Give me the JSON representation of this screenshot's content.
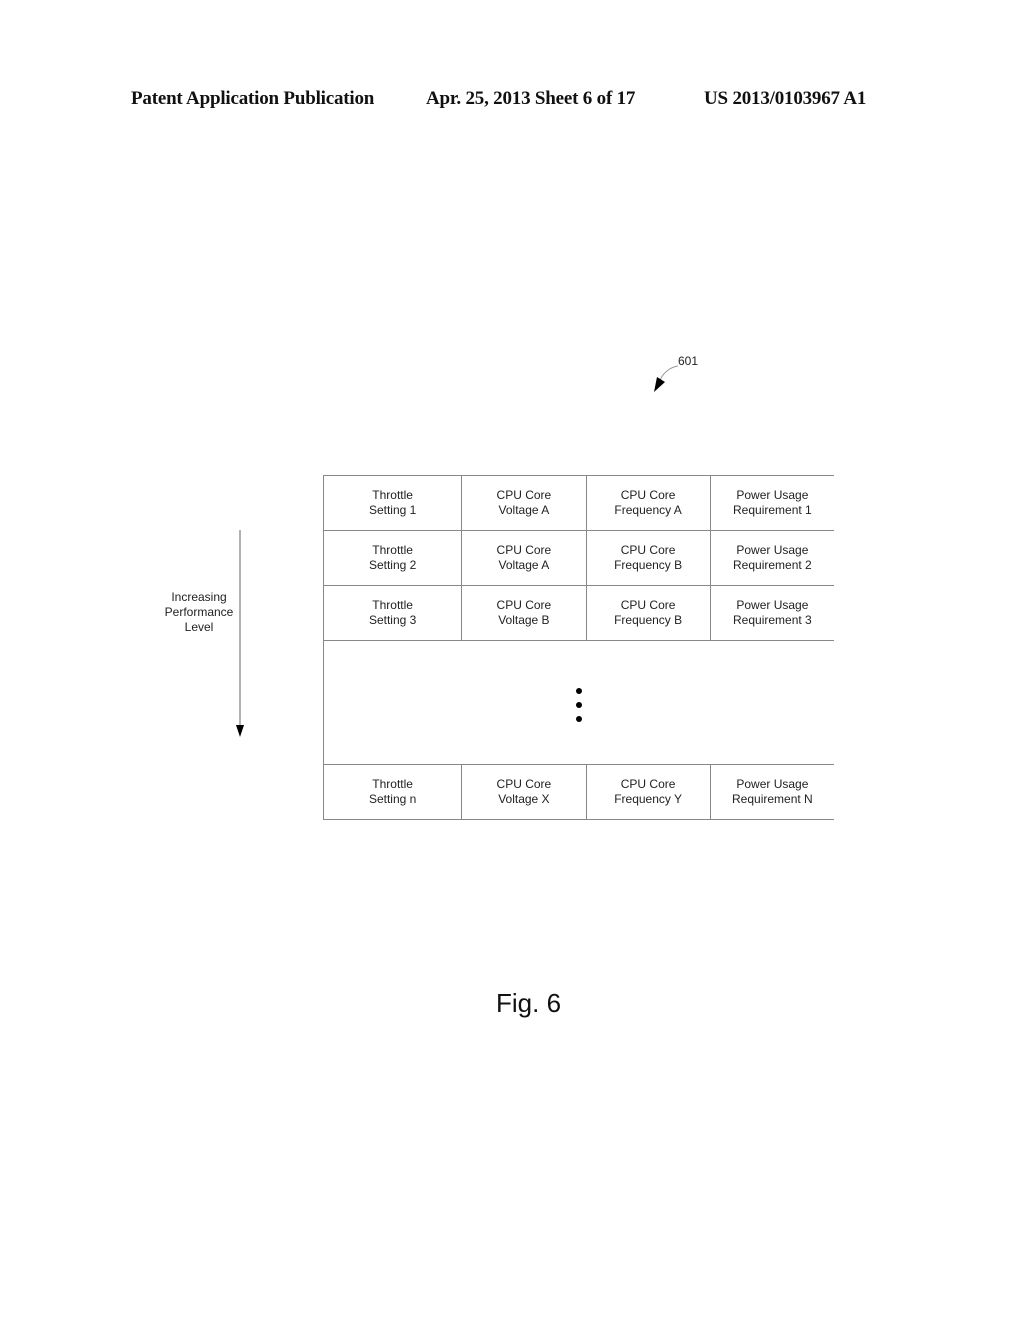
{
  "header": {
    "publication": "Patent Application Publication",
    "date_sheet": "Apr. 25, 2013  Sheet 6 of 17",
    "patent_number": "US 2013/0103967 A1"
  },
  "diagram": {
    "reference_numeral": "601",
    "axis_label_lines": [
      "Increasing",
      "Performance",
      "Level"
    ],
    "axis_direction": "down",
    "table": {
      "rows": [
        [
          [
            "Throttle",
            "Setting 1"
          ],
          [
            "CPU Core",
            "Voltage A"
          ],
          [
            "CPU Core",
            "Frequency A"
          ],
          [
            "Power Usage",
            "Requirement 1"
          ]
        ],
        [
          [
            "Throttle",
            "Setting 2"
          ],
          [
            "CPU Core",
            "Voltage A"
          ],
          [
            "CPU Core",
            "Frequency B"
          ],
          [
            "Power Usage",
            "Requirement 2"
          ]
        ],
        [
          [
            "Throttle",
            "Setting 3"
          ],
          [
            "CPU Core",
            "Voltage B"
          ],
          [
            "CPU Core",
            "Frequency B"
          ],
          [
            "Power Usage",
            "Requirement 3"
          ]
        ]
      ],
      "ellipsis": "vertical-ellipsis",
      "last_row": [
        [
          "Throttle",
          "Setting n"
        ],
        [
          "CPU Core",
          "Voltage X"
        ],
        [
          "CPU Core",
          "Frequency Y"
        ],
        [
          "Power Usage",
          "Requirement N"
        ]
      ]
    },
    "figure_label": "Fig. 6"
  }
}
